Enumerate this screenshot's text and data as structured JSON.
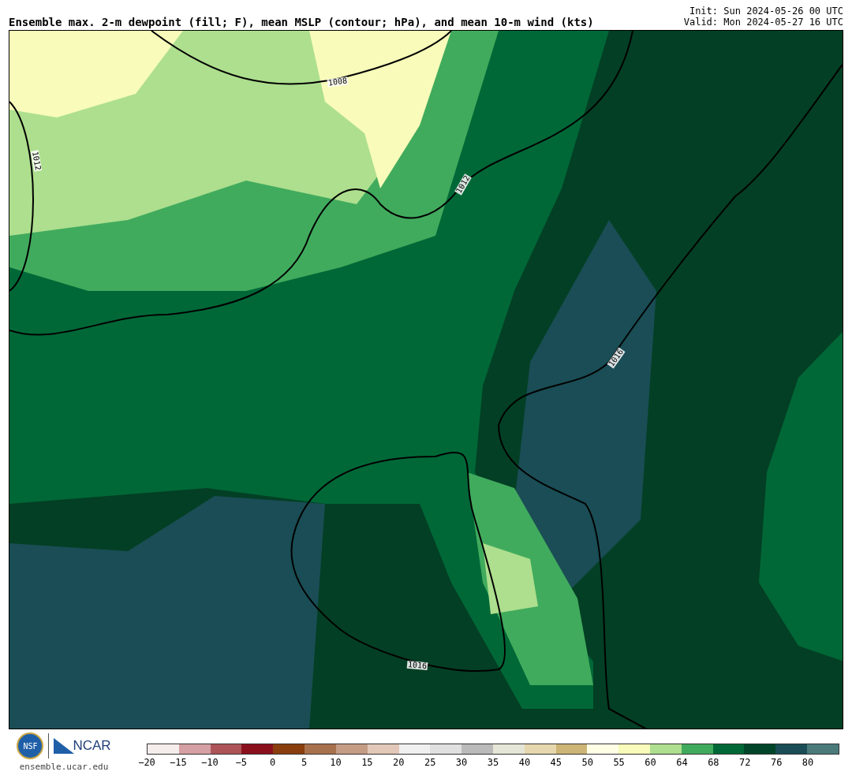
{
  "title": "Ensemble max. 2-m dewpoint (fill; F), mean MSLP (contour; hPa), and mean 10-m wind (kts)",
  "init": "Init: Sun 2024-05-26 00 UTC",
  "valid": "Valid: Mon 2024-05-27 16 UTC",
  "map": {
    "contour_labels": [
      "1008",
      "1012",
      "1012",
      "1016",
      "1016"
    ]
  },
  "footer": {
    "site": "ensemble.ucar.edu",
    "logo_text": "NCAR",
    "seal_text": "NSF"
  },
  "colorbar": {
    "segments": [
      {
        "color": "#f5ecec"
      },
      {
        "color": "#d4a0a3"
      },
      {
        "color": "#ad5458"
      },
      {
        "color": "#8b101e"
      },
      {
        "color": "#8a3e0e"
      },
      {
        "color": "#a8714d"
      },
      {
        "color": "#c59d85"
      },
      {
        "color": "#e2c8b8"
      },
      {
        "color": "#f0f0f0"
      },
      {
        "color": "#e0e0e0"
      },
      {
        "color": "#bababa"
      },
      {
        "color": "#e6e6d7"
      },
      {
        "color": "#e6d7ae"
      },
      {
        "color": "#cdb576"
      },
      {
        "color": "#ffffe6"
      },
      {
        "color": "#f8fbb9"
      },
      {
        "color": "#addf8e"
      },
      {
        "color": "#41ab5d"
      },
      {
        "color": "#006837"
      },
      {
        "color": "#004529"
      },
      {
        "color": "#1a4d55"
      },
      {
        "color": "#4a7a7a"
      }
    ],
    "ticks": [
      "−20",
      "−15",
      "−10",
      "−5",
      "0",
      "5",
      "10",
      "15",
      "20",
      "25",
      "30",
      "35",
      "40",
      "45",
      "50",
      "55",
      "60",
      "64",
      "68",
      "72",
      "76",
      "80"
    ]
  }
}
